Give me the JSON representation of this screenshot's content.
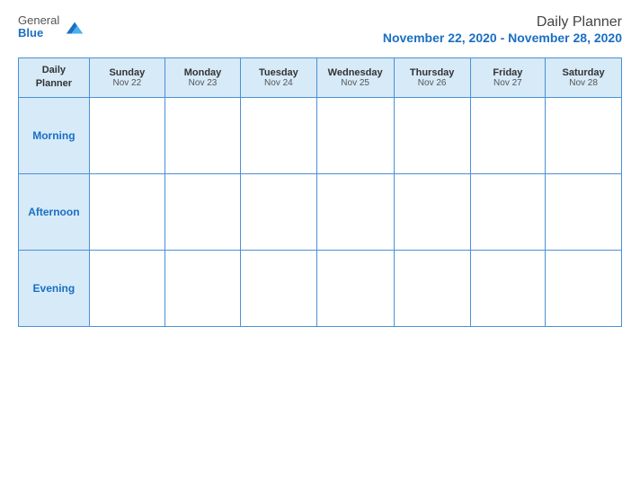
{
  "header": {
    "logo": {
      "general": "General",
      "blue": "Blue"
    },
    "title": "Daily Planner",
    "date_range": "November 22, 2020 - November 28, 2020"
  },
  "table": {
    "header_label": "Daily\nPlanner",
    "days": [
      {
        "name": "Sunday",
        "date": "Nov 22"
      },
      {
        "name": "Monday",
        "date": "Nov 23"
      },
      {
        "name": "Tuesday",
        "date": "Nov 24"
      },
      {
        "name": "Wednesday",
        "date": "Nov 25"
      },
      {
        "name": "Thursday",
        "date": "Nov 26"
      },
      {
        "name": "Friday",
        "date": "Nov 27"
      },
      {
        "name": "Saturday",
        "date": "Nov 28"
      }
    ],
    "rows": [
      {
        "label": "Morning"
      },
      {
        "label": "Afternoon"
      },
      {
        "label": "Evening"
      }
    ]
  }
}
